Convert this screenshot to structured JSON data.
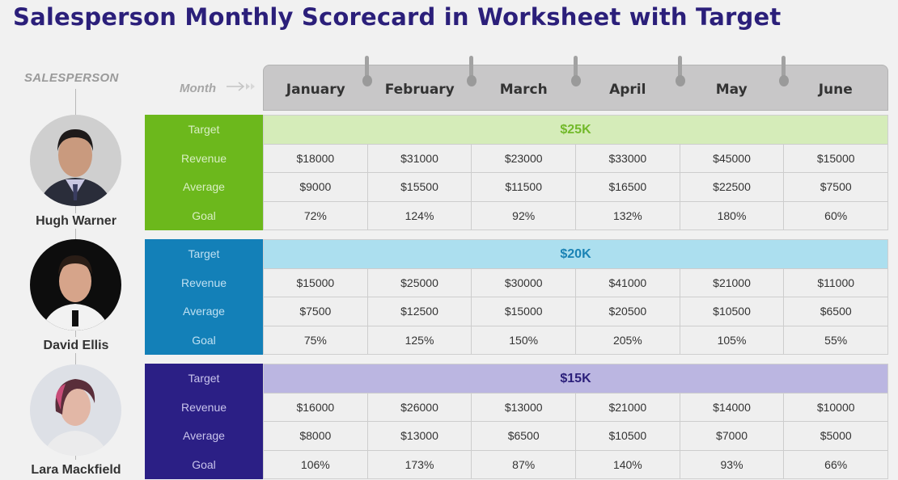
{
  "title": "Salesperson Monthly Scorecard in Worksheet with Target",
  "header": {
    "salesperson_label": "SALESPERSON",
    "month_label": "Month",
    "month_arrow_icon": "double-arrow-right",
    "months": [
      "January",
      "February",
      "March",
      "April",
      "May",
      "June"
    ]
  },
  "row_labels": [
    "Target",
    "Revenue",
    "Average",
    "Goal"
  ],
  "salespeople": [
    {
      "name": "Hugh Warner",
      "target": "$25K",
      "colors": {
        "label_bg": "#6cb81c",
        "label_text": "#d9efc4",
        "target_bg": "#d5ecb9",
        "target_text": "#72b92a"
      },
      "revenue": [
        "$18000",
        "$31000",
        "$23000",
        "$33000",
        "$45000",
        "$15000"
      ],
      "average": [
        "$9000",
        "$15500",
        "$11500",
        "$16500",
        "$22500",
        "$7500"
      ],
      "goal": [
        "72%",
        "124%",
        "92%",
        "132%",
        "180%",
        "60%"
      ]
    },
    {
      "name": "David Ellis",
      "target": "$20K",
      "colors": {
        "label_bg": "#1380b8",
        "label_text": "#bfe0f2",
        "target_bg": "#acdfef",
        "target_text": "#1a83b5"
      },
      "revenue": [
        "$15000",
        "$25000",
        "$30000",
        "$41000",
        "$21000",
        "$11000"
      ],
      "average": [
        "$7500",
        "$12500",
        "$15000",
        "$20500",
        "$10500",
        "$6500"
      ],
      "goal": [
        "75%",
        "125%",
        "150%",
        "205%",
        "105%",
        "55%"
      ]
    },
    {
      "name": "Lara Mackfield",
      "target": "$15K",
      "colors": {
        "label_bg": "#2b1f85",
        "label_text": "#c9c4ec",
        "target_bg": "#bbb6e1",
        "target_text": "#2b1f7a"
      },
      "revenue": [
        "$16000",
        "$26000",
        "$13000",
        "$21000",
        "$14000",
        "$10000"
      ],
      "average": [
        "$8000",
        "$13000",
        "$6500",
        "$10500",
        "$7000",
        "$5000"
      ],
      "goal": [
        "106%",
        "173%",
        "87%",
        "140%",
        "93%",
        "66%"
      ]
    }
  ]
}
